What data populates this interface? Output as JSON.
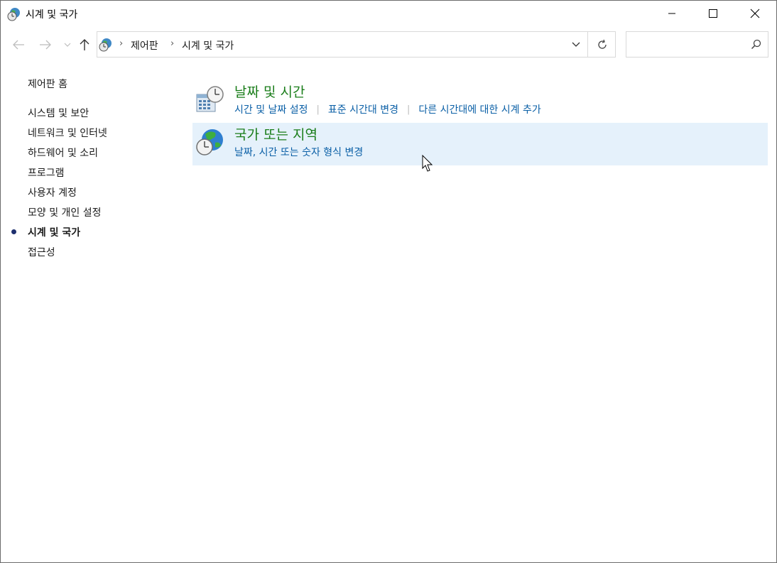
{
  "window": {
    "title": "시계 및 국가",
    "controls": {
      "minimize": "minimize",
      "maximize": "maximize",
      "close": "close"
    }
  },
  "navigation": {
    "breadcrumb": [
      "제어판",
      "시계 및 국가"
    ],
    "search": {
      "value": "",
      "placeholder": ""
    }
  },
  "sidebar": {
    "home": "제어판 홈",
    "items": [
      {
        "label": "시스템 및 보안",
        "active": false
      },
      {
        "label": "네트워크 및 인터넷",
        "active": false
      },
      {
        "label": "하드웨어 및 소리",
        "active": false
      },
      {
        "label": "프로그램",
        "active": false
      },
      {
        "label": "사용자 계정",
        "active": false
      },
      {
        "label": "모양 및 개인 설정",
        "active": false
      },
      {
        "label": "시계 및 국가",
        "active": true
      },
      {
        "label": "접근성",
        "active": false
      }
    ]
  },
  "main": {
    "categories": [
      {
        "title": "날짜 및 시간",
        "icon": "calendar-clock-icon",
        "links": [
          "시간 및 날짜 설정",
          "표준 시간대 변경",
          "다른 시간대에 대한 시계 추가"
        ]
      },
      {
        "title": "국가 또는 지역",
        "icon": "globe-clock-icon",
        "links": [
          "날짜, 시간 또는 숫자 형식 변경"
        ],
        "hovered": true
      }
    ]
  },
  "colors": {
    "category_title": "#1a7d1a",
    "link": "#0a5fa6",
    "hover_background": "#e5f1fb",
    "active_bullet": "#1e2f6e"
  }
}
